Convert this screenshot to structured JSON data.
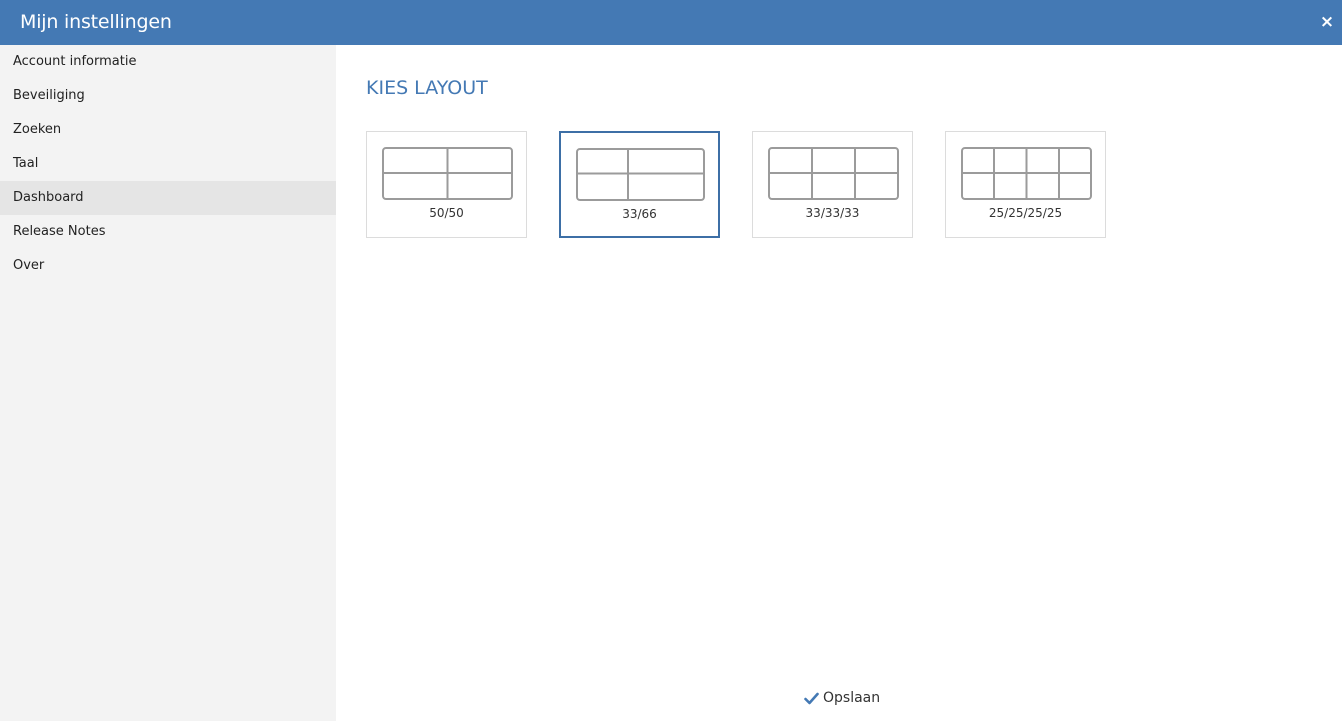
{
  "header": {
    "title": "Mijn instellingen",
    "close_label": "×",
    "background": "#4479b4"
  },
  "sidebar": {
    "items": [
      {
        "label": "Account informatie",
        "active": false
      },
      {
        "label": "Beveiliging",
        "active": false
      },
      {
        "label": "Zoeken",
        "active": false
      },
      {
        "label": "Taal",
        "active": false
      },
      {
        "label": "Dashboard",
        "active": true
      },
      {
        "label": "Release Notes",
        "active": false
      },
      {
        "label": "Over",
        "active": false
      }
    ]
  },
  "main": {
    "section_title": "KIES LAYOUT",
    "layouts": [
      {
        "label": "50/50",
        "selected": false,
        "icon": "grid-2-columns-icon"
      },
      {
        "label": "33/66",
        "selected": true,
        "icon": "grid-33-66-icon"
      },
      {
        "label": "33/33/33",
        "selected": false,
        "icon": "grid-3-columns-icon"
      },
      {
        "label": "25/25/25/25",
        "selected": false,
        "icon": "grid-4-columns-icon"
      }
    ],
    "save_label": "Opslaan",
    "accent": "#4479b4"
  }
}
